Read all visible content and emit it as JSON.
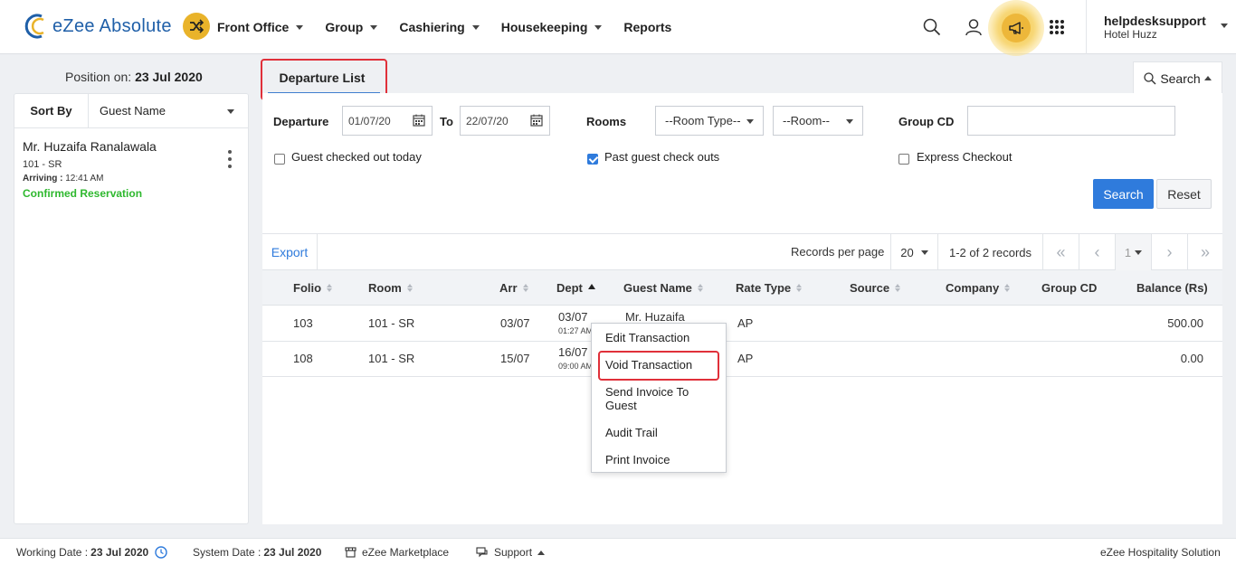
{
  "app": {
    "title": "eZee Absolute"
  },
  "nav": [
    {
      "label": "Front Office"
    },
    {
      "label": "Group"
    },
    {
      "label": "Cashiering"
    },
    {
      "label": "Housekeeping"
    },
    {
      "label": "Reports"
    }
  ],
  "user": {
    "name": "helpdesksupport",
    "hotel": "Hotel Huzz"
  },
  "position": {
    "label": "Position on:",
    "date": "23 Jul 2020"
  },
  "left_panel": {
    "sort_by_label": "Sort By",
    "sort_value": "Guest Name",
    "guest": {
      "name": "Mr. Huzaifa Ranalawala",
      "room": "101 - SR",
      "arriving_label": "Arriving :",
      "arriving_time": "12:41 AM",
      "status": "Confirmed Reservation"
    }
  },
  "tabs": {
    "departure_list": "Departure List",
    "search": "Search"
  },
  "filters": {
    "departure_label": "Departure",
    "from_date": "01/07/20",
    "to_label": "To",
    "to_date": "22/07/20",
    "rooms_label": "Rooms",
    "room_type": "--Room Type--",
    "room": "--Room--",
    "group_cd_label": "Group CD",
    "group_cd_value": "",
    "guest_checked_out_today": {
      "label": "Guest checked out today",
      "checked": false
    },
    "past_guest_check_outs": {
      "label": "Past guest check outs",
      "checked": true
    },
    "express_checkout": {
      "label": "Express Checkout",
      "checked": false
    },
    "search_button": "Search",
    "reset_button": "Reset"
  },
  "grid_toolbar": {
    "export": "Export",
    "records_per_page_label": "Records per page",
    "records_per_page": "20",
    "records_info": "1-2 of 2 records",
    "page": "1"
  },
  "table": {
    "columns": [
      "Folio",
      "Room",
      "Arr",
      "Dept",
      "Guest Name",
      "Rate Type",
      "Source",
      "Company",
      "Group CD",
      "Balance (Rs)"
    ],
    "rows": [
      {
        "folio": "103",
        "room": "101 - SR",
        "arr": "03/07",
        "dept": "03/07",
        "dept_time": "01:27 AM",
        "guest": "Mr. Huzaifa",
        "rate_type": "AP",
        "source": "",
        "company": "",
        "group_cd": "",
        "balance": "500.00"
      },
      {
        "folio": "108",
        "room": "101 - SR",
        "arr": "15/07",
        "dept": "16/07",
        "dept_time": "09:00 AM",
        "guest": "",
        "rate_type": "AP",
        "source": "",
        "company": "",
        "group_cd": "",
        "balance": "0.00"
      }
    ]
  },
  "context_menu": {
    "items": [
      "Edit Transaction",
      "Void Transaction",
      "Send Invoice To Guest",
      "Audit Trail",
      "Print Invoice"
    ]
  },
  "footer": {
    "working_date_label": "Working Date :",
    "working_date": "23 Jul 2020",
    "system_date_label": "System Date :",
    "system_date": "23 Jul 2020",
    "marketplace": "eZee Marketplace",
    "support": "Support",
    "brand": "eZee Hospitality Solution"
  },
  "colors": {
    "accent": "#2f7bdc",
    "brand": "#1f5fa8",
    "highlight": "#e0303a",
    "status_green": "#2eb82e",
    "notification": "#edb73a"
  }
}
